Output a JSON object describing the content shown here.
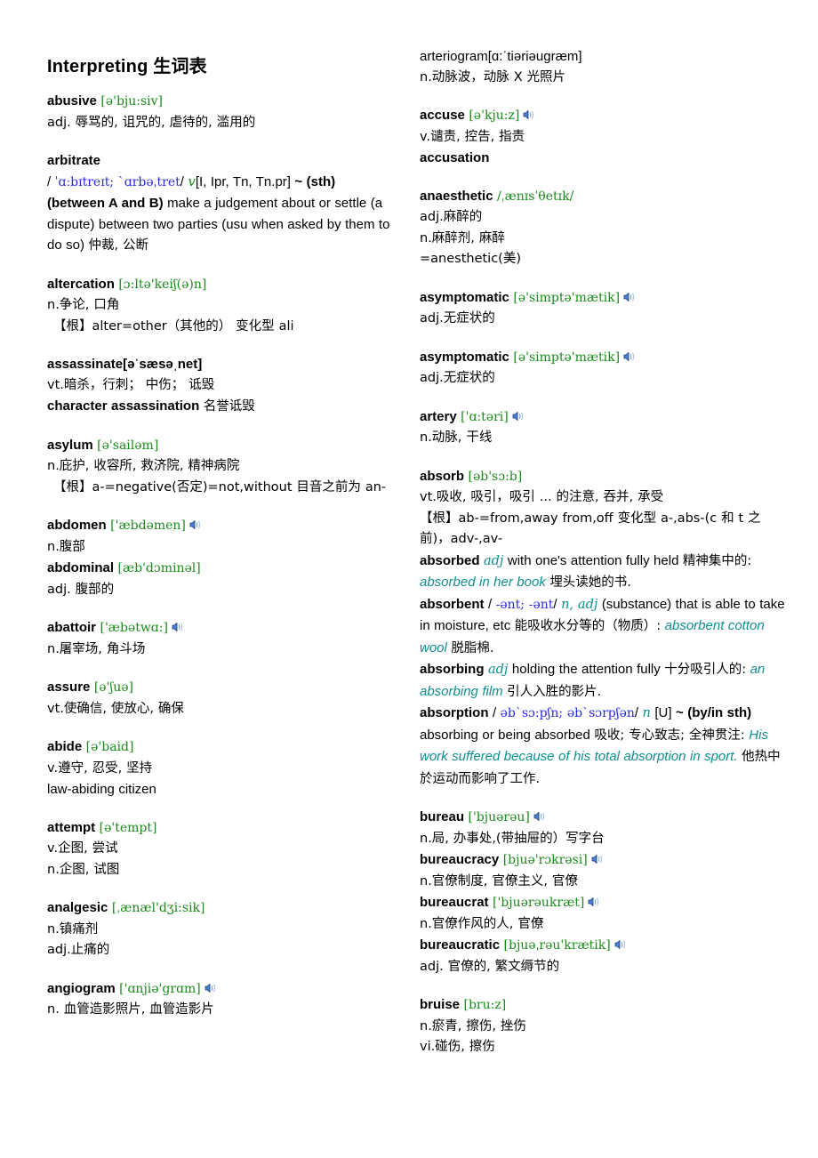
{
  "document": {
    "title_en": "Interpreting",
    "title_cjk": "生词表"
  },
  "icons": {
    "speaker": "speaker-icon"
  },
  "colors": {
    "ipa_green": "#1a8a1a",
    "ipa_blue": "#2a2ae0",
    "example_teal": "#0e8f8f",
    "text_black": "#000000",
    "background": "#ffffff"
  },
  "left_column": {
    "entries": [
      {
        "headword": "abusive",
        "phonetic": "[ə'bju:siv]",
        "phonetic_color": "green",
        "speaker": false,
        "lines": [
          "adj. 辱骂的, 诅咒的, 虐待的, 滥用的"
        ]
      },
      {
        "headword": "arbitrate",
        "phonetic": "",
        "phonetic_color": "none",
        "speaker": false,
        "lines": [
          "/ ˈɑːbɪtreɪt; ˋɑrbəˌtret/ v [I, Ipr, Tn, Tn.pr] ~ (sth) (between A and B) make a judgement about or settle (a dispute) between two parties (usu when asked by them to do so) 仲裁, 公断"
        ],
        "ipa_inline": "ˈɑːbɪtreɪt; ˋɑrbəˌtret",
        "pos_inline": "v",
        "grammar": "[I, Ipr, Tn, Tn.pr]",
        "pattern": "~ (sth) (between A and B)",
        "definition_en": "make a judgement about or settle (a dispute) between two parties (usu when asked by them to do so)",
        "definition_cjk": "仲裁, 公断"
      },
      {
        "headword": "altercation",
        "phonetic": "[ɔ:ltə'keiʃ(ə)n]",
        "phonetic_color": "green",
        "speaker": false,
        "lines": [
          "n.争论, 口角",
          "【根】alter=other（其他的） 变化型 ali"
        ]
      },
      {
        "headword": "assassinate",
        "phonetic": "[əˈsæsəˌnet]",
        "phonetic_color": "black",
        "speaker": false,
        "lines": [
          "vt.暗杀，行刺； 中伤； 诋毁",
          "character assassination 名誉诋毁"
        ],
        "derived": "character assassination",
        "derived_cjk": "名誉诋毁"
      },
      {
        "headword": "asylum",
        "phonetic": "[ə'sailəm]",
        "phonetic_color": "green",
        "speaker": false,
        "lines": [
          "n.庇护, 收容所, 救济院, 精神病院",
          "【根】a-=negative(否定)=not,without 目音之前为 an-"
        ]
      },
      {
        "headword": "abdomen",
        "phonetic": "['æbdəmen]",
        "phonetic_color": "green",
        "speaker": true,
        "lines": [
          "n.腹部"
        ],
        "sub_headword": "abdominal",
        "sub_phonetic": "[æb'dɔminəl]",
        "sub_lines": [
          "adj. 腹部的"
        ]
      },
      {
        "headword": "abattoir",
        "phonetic": "['æbətwɑ:]",
        "phonetic_color": "green",
        "speaker": true,
        "lines": [
          "n.屠宰场, 角斗场"
        ]
      },
      {
        "headword": "assure",
        "phonetic": "[ə'ʃuə]",
        "phonetic_color": "green",
        "speaker": false,
        "lines": [
          "vt.使确信, 使放心, 确保"
        ]
      },
      {
        "headword": "abide",
        "phonetic": "[ə'baid]",
        "phonetic_color": "green",
        "speaker": false,
        "lines": [
          "v.遵守, 忍受, 坚持",
          "law-abiding citizen"
        ]
      },
      {
        "headword": "attempt",
        "phonetic": "[ə'tempt]",
        "phonetic_color": "green",
        "speaker": false,
        "lines": [
          "v.企图, 尝试",
          "n.企图, 试图"
        ]
      },
      {
        "headword": "analgesic",
        "phonetic": "[ˌænæl'dʒi:sik]",
        "phonetic_color": "green",
        "speaker": false,
        "lines": [
          "n.镇痛剂",
          "adj.止痛的"
        ]
      },
      {
        "headword": "angiogram",
        "phonetic": "['ɑnjiə'grɑm]",
        "phonetic_color": "green",
        "speaker": true,
        "lines": [
          "n. 血管造影照片, 血管造影片"
        ]
      }
    ]
  },
  "right_column": {
    "entries": [
      {
        "headword": "arteriogram",
        "headword_bold": false,
        "phonetic": "[ɑ:ˈtiəriəugræm]",
        "phonetic_color": "black-plain",
        "speaker": false,
        "lines": [
          "n.动脉波，动脉 X 光照片"
        ]
      },
      {
        "headword": "accuse",
        "phonetic": "[ə'kju:z]",
        "phonetic_color": "green",
        "speaker": true,
        "lines": [
          "v.谴责, 控告, 指责",
          "accusation"
        ],
        "derived": "accusation"
      },
      {
        "headword": "anaesthetic",
        "phonetic": "/ˌænɪsˈθetɪk/",
        "phonetic_color": "green-slash",
        "speaker": false,
        "lines": [
          "adj.麻醉的",
          "n.麻醉剂, 麻醉",
          "=anesthetic(美)"
        ]
      },
      {
        "headword": "asymptomatic",
        "phonetic": "[ə'simptə'mætik]",
        "phonetic_color": "green",
        "speaker": true,
        "lines": [
          "adj.无症状的"
        ]
      },
      {
        "headword": "asymptomatic",
        "phonetic": "[ə'simptə'mætik]",
        "phonetic_color": "green",
        "speaker": true,
        "lines": [
          "adj.无症状的"
        ]
      },
      {
        "headword": "artery",
        "phonetic": "['ɑ:təri]",
        "phonetic_color": "green",
        "speaker": true,
        "lines": [
          "n.动脉, 干线"
        ]
      },
      {
        "headword": "absorb",
        "phonetic": "[əb'sɔ:b]",
        "phonetic_color": "green",
        "speaker": false,
        "lines": [
          "vt.吸收, 吸引，吸引 ... 的注意, 吞并, 承受",
          "【根】ab-=from,away from,off 变化型 a-,abs-(c 和 t 之前)，adv-,av-"
        ],
        "subentries": [
          {
            "word": "absorbed",
            "pos": "adj",
            "definition_en": "with one's attention fully held",
            "definition_cjk": "精神集中的:",
            "example": "absorbed in her book",
            "example_cjk": "埋头读她的书."
          },
          {
            "word": "absorbent",
            "ipa": "-ənt; -ənt",
            "pos": "n, adj",
            "definition_en": "(substance) that is able to take in moisture, etc",
            "definition_cjk": "能吸收水分等的（物质）:",
            "example": "absorbent cotton wool",
            "example_cjk": "脱脂棉."
          },
          {
            "word": "absorbing",
            "pos": "adj",
            "definition_en": "holding the attention fully",
            "definition_cjk": "十分吸引人的:",
            "example": "an absorbing film",
            "example_cjk": "引人入胜的影片."
          },
          {
            "word": "absorption",
            "ipa": "əbˋsɔ:pʃn; əbˋsɔrpʃən",
            "pos": "n",
            "grammar": "[U]",
            "pattern": "~ (by/in sth)",
            "definition_en": "absorbing or being absorbed",
            "definition_cjk": "吸收; 专心致志; 全神贯注:",
            "example": "His work suffered because of his total absorption in sport.",
            "example_cjk": "他热中於运动而影响了工作."
          }
        ]
      },
      {
        "headword": "bureau",
        "phonetic": "['bjuərəu]",
        "phonetic_color": "green",
        "speaker": true,
        "lines": [
          "n.局, 办事处,(带抽屉的）写字台"
        ],
        "family": [
          {
            "word": "bureaucracy",
            "phonetic": "[bjuə'rɔkrəsi]",
            "speaker": true,
            "def": "n.官僚制度, 官僚主义, 官僚"
          },
          {
            "word": "bureaucrat",
            "phonetic": "['bjuərəukræt]",
            "speaker": true,
            "def": "n.官僚作风的人, 官僚"
          },
          {
            "word": "bureaucratic",
            "phonetic": "[bjuəˌrəu'krætik]",
            "speaker": true,
            "def": "adj. 官僚的, 繁文缛节的"
          }
        ]
      },
      {
        "headword": "bruise",
        "phonetic": "[bru:z]",
        "phonetic_color": "green",
        "speaker": false,
        "lines": [
          "n.瘀青, 擦伤, 挫伤",
          "vi.碰伤, 擦伤"
        ]
      }
    ]
  }
}
